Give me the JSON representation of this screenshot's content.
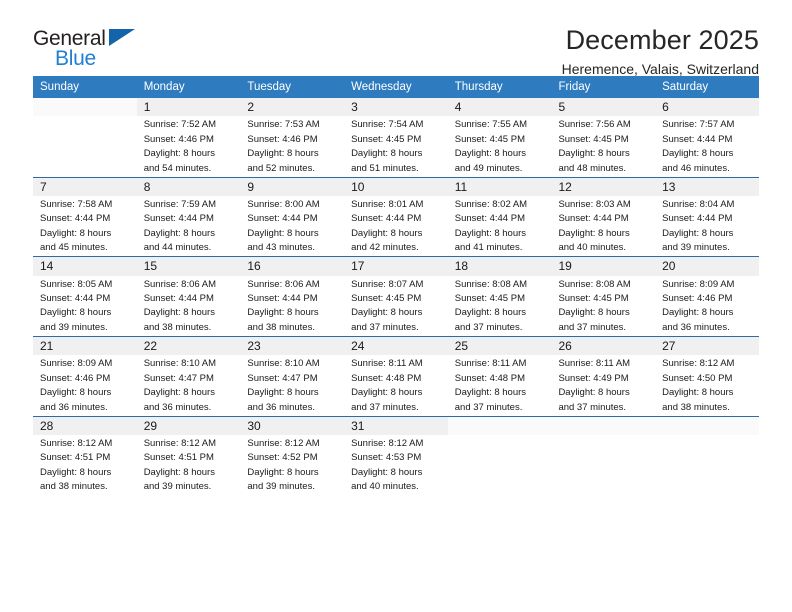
{
  "logo": {
    "word1": "General",
    "word2": "Blue",
    "triangle_color": "#1464aa",
    "blue_color": "#1f7fd0"
  },
  "header": {
    "title": "December 2025",
    "subtitle": "Heremence, Valais, Switzerland"
  },
  "theme": {
    "header_row_bg": "#2e7bbf",
    "daynum_bg": "#f0f0f0",
    "week_divider": "#2e6da4",
    "text": "#1a1a1a"
  },
  "weekday_headers": [
    "Sunday",
    "Monday",
    "Tuesday",
    "Wednesday",
    "Thursday",
    "Friday",
    "Saturday"
  ],
  "weeks": [
    {
      "days": [
        {
          "num": "",
          "sunrise": "",
          "sunset": "",
          "daylight1": "",
          "daylight2": "",
          "empty": true
        },
        {
          "num": "1",
          "sunrise": "Sunrise: 7:52 AM",
          "sunset": "Sunset: 4:46 PM",
          "daylight1": "Daylight: 8 hours",
          "daylight2": "and 54 minutes.",
          "empty": false
        },
        {
          "num": "2",
          "sunrise": "Sunrise: 7:53 AM",
          "sunset": "Sunset: 4:46 PM",
          "daylight1": "Daylight: 8 hours",
          "daylight2": "and 52 minutes.",
          "empty": false
        },
        {
          "num": "3",
          "sunrise": "Sunrise: 7:54 AM",
          "sunset": "Sunset: 4:45 PM",
          "daylight1": "Daylight: 8 hours",
          "daylight2": "and 51 minutes.",
          "empty": false
        },
        {
          "num": "4",
          "sunrise": "Sunrise: 7:55 AM",
          "sunset": "Sunset: 4:45 PM",
          "daylight1": "Daylight: 8 hours",
          "daylight2": "and 49 minutes.",
          "empty": false
        },
        {
          "num": "5",
          "sunrise": "Sunrise: 7:56 AM",
          "sunset": "Sunset: 4:45 PM",
          "daylight1": "Daylight: 8 hours",
          "daylight2": "and 48 minutes.",
          "empty": false
        },
        {
          "num": "6",
          "sunrise": "Sunrise: 7:57 AM",
          "sunset": "Sunset: 4:44 PM",
          "daylight1": "Daylight: 8 hours",
          "daylight2": "and 46 minutes.",
          "empty": false
        }
      ]
    },
    {
      "days": [
        {
          "num": "7",
          "sunrise": "Sunrise: 7:58 AM",
          "sunset": "Sunset: 4:44 PM",
          "daylight1": "Daylight: 8 hours",
          "daylight2": "and 45 minutes.",
          "empty": false
        },
        {
          "num": "8",
          "sunrise": "Sunrise: 7:59 AM",
          "sunset": "Sunset: 4:44 PM",
          "daylight1": "Daylight: 8 hours",
          "daylight2": "and 44 minutes.",
          "empty": false
        },
        {
          "num": "9",
          "sunrise": "Sunrise: 8:00 AM",
          "sunset": "Sunset: 4:44 PM",
          "daylight1": "Daylight: 8 hours",
          "daylight2": "and 43 minutes.",
          "empty": false
        },
        {
          "num": "10",
          "sunrise": "Sunrise: 8:01 AM",
          "sunset": "Sunset: 4:44 PM",
          "daylight1": "Daylight: 8 hours",
          "daylight2": "and 42 minutes.",
          "empty": false
        },
        {
          "num": "11",
          "sunrise": "Sunrise: 8:02 AM",
          "sunset": "Sunset: 4:44 PM",
          "daylight1": "Daylight: 8 hours",
          "daylight2": "and 41 minutes.",
          "empty": false
        },
        {
          "num": "12",
          "sunrise": "Sunrise: 8:03 AM",
          "sunset": "Sunset: 4:44 PM",
          "daylight1": "Daylight: 8 hours",
          "daylight2": "and 40 minutes.",
          "empty": false
        },
        {
          "num": "13",
          "sunrise": "Sunrise: 8:04 AM",
          "sunset": "Sunset: 4:44 PM",
          "daylight1": "Daylight: 8 hours",
          "daylight2": "and 39 minutes.",
          "empty": false
        }
      ]
    },
    {
      "days": [
        {
          "num": "14",
          "sunrise": "Sunrise: 8:05 AM",
          "sunset": "Sunset: 4:44 PM",
          "daylight1": "Daylight: 8 hours",
          "daylight2": "and 39 minutes.",
          "empty": false
        },
        {
          "num": "15",
          "sunrise": "Sunrise: 8:06 AM",
          "sunset": "Sunset: 4:44 PM",
          "daylight1": "Daylight: 8 hours",
          "daylight2": "and 38 minutes.",
          "empty": false
        },
        {
          "num": "16",
          "sunrise": "Sunrise: 8:06 AM",
          "sunset": "Sunset: 4:44 PM",
          "daylight1": "Daylight: 8 hours",
          "daylight2": "and 38 minutes.",
          "empty": false
        },
        {
          "num": "17",
          "sunrise": "Sunrise: 8:07 AM",
          "sunset": "Sunset: 4:45 PM",
          "daylight1": "Daylight: 8 hours",
          "daylight2": "and 37 minutes.",
          "empty": false
        },
        {
          "num": "18",
          "sunrise": "Sunrise: 8:08 AM",
          "sunset": "Sunset: 4:45 PM",
          "daylight1": "Daylight: 8 hours",
          "daylight2": "and 37 minutes.",
          "empty": false
        },
        {
          "num": "19",
          "sunrise": "Sunrise: 8:08 AM",
          "sunset": "Sunset: 4:45 PM",
          "daylight1": "Daylight: 8 hours",
          "daylight2": "and 37 minutes.",
          "empty": false
        },
        {
          "num": "20",
          "sunrise": "Sunrise: 8:09 AM",
          "sunset": "Sunset: 4:46 PM",
          "daylight1": "Daylight: 8 hours",
          "daylight2": "and 36 minutes.",
          "empty": false
        }
      ]
    },
    {
      "days": [
        {
          "num": "21",
          "sunrise": "Sunrise: 8:09 AM",
          "sunset": "Sunset: 4:46 PM",
          "daylight1": "Daylight: 8 hours",
          "daylight2": "and 36 minutes.",
          "empty": false
        },
        {
          "num": "22",
          "sunrise": "Sunrise: 8:10 AM",
          "sunset": "Sunset: 4:47 PM",
          "daylight1": "Daylight: 8 hours",
          "daylight2": "and 36 minutes.",
          "empty": false
        },
        {
          "num": "23",
          "sunrise": "Sunrise: 8:10 AM",
          "sunset": "Sunset: 4:47 PM",
          "daylight1": "Daylight: 8 hours",
          "daylight2": "and 36 minutes.",
          "empty": false
        },
        {
          "num": "24",
          "sunrise": "Sunrise: 8:11 AM",
          "sunset": "Sunset: 4:48 PM",
          "daylight1": "Daylight: 8 hours",
          "daylight2": "and 37 minutes.",
          "empty": false
        },
        {
          "num": "25",
          "sunrise": "Sunrise: 8:11 AM",
          "sunset": "Sunset: 4:48 PM",
          "daylight1": "Daylight: 8 hours",
          "daylight2": "and 37 minutes.",
          "empty": false
        },
        {
          "num": "26",
          "sunrise": "Sunrise: 8:11 AM",
          "sunset": "Sunset: 4:49 PM",
          "daylight1": "Daylight: 8 hours",
          "daylight2": "and 37 minutes.",
          "empty": false
        },
        {
          "num": "27",
          "sunrise": "Sunrise: 8:12 AM",
          "sunset": "Sunset: 4:50 PM",
          "daylight1": "Daylight: 8 hours",
          "daylight2": "and 38 minutes.",
          "empty": false
        }
      ]
    },
    {
      "days": [
        {
          "num": "28",
          "sunrise": "Sunrise: 8:12 AM",
          "sunset": "Sunset: 4:51 PM",
          "daylight1": "Daylight: 8 hours",
          "daylight2": "and 38 minutes.",
          "empty": false
        },
        {
          "num": "29",
          "sunrise": "Sunrise: 8:12 AM",
          "sunset": "Sunset: 4:51 PM",
          "daylight1": "Daylight: 8 hours",
          "daylight2": "and 39 minutes.",
          "empty": false
        },
        {
          "num": "30",
          "sunrise": "Sunrise: 8:12 AM",
          "sunset": "Sunset: 4:52 PM",
          "daylight1": "Daylight: 8 hours",
          "daylight2": "and 39 minutes.",
          "empty": false
        },
        {
          "num": "31",
          "sunrise": "Sunrise: 8:12 AM",
          "sunset": "Sunset: 4:53 PM",
          "daylight1": "Daylight: 8 hours",
          "daylight2": "and 40 minutes.",
          "empty": false
        },
        {
          "num": "",
          "sunrise": "",
          "sunset": "",
          "daylight1": "",
          "daylight2": "",
          "empty": true
        },
        {
          "num": "",
          "sunrise": "",
          "sunset": "",
          "daylight1": "",
          "daylight2": "",
          "empty": true
        },
        {
          "num": "",
          "sunrise": "",
          "sunset": "",
          "daylight1": "",
          "daylight2": "",
          "empty": true
        }
      ]
    }
  ]
}
